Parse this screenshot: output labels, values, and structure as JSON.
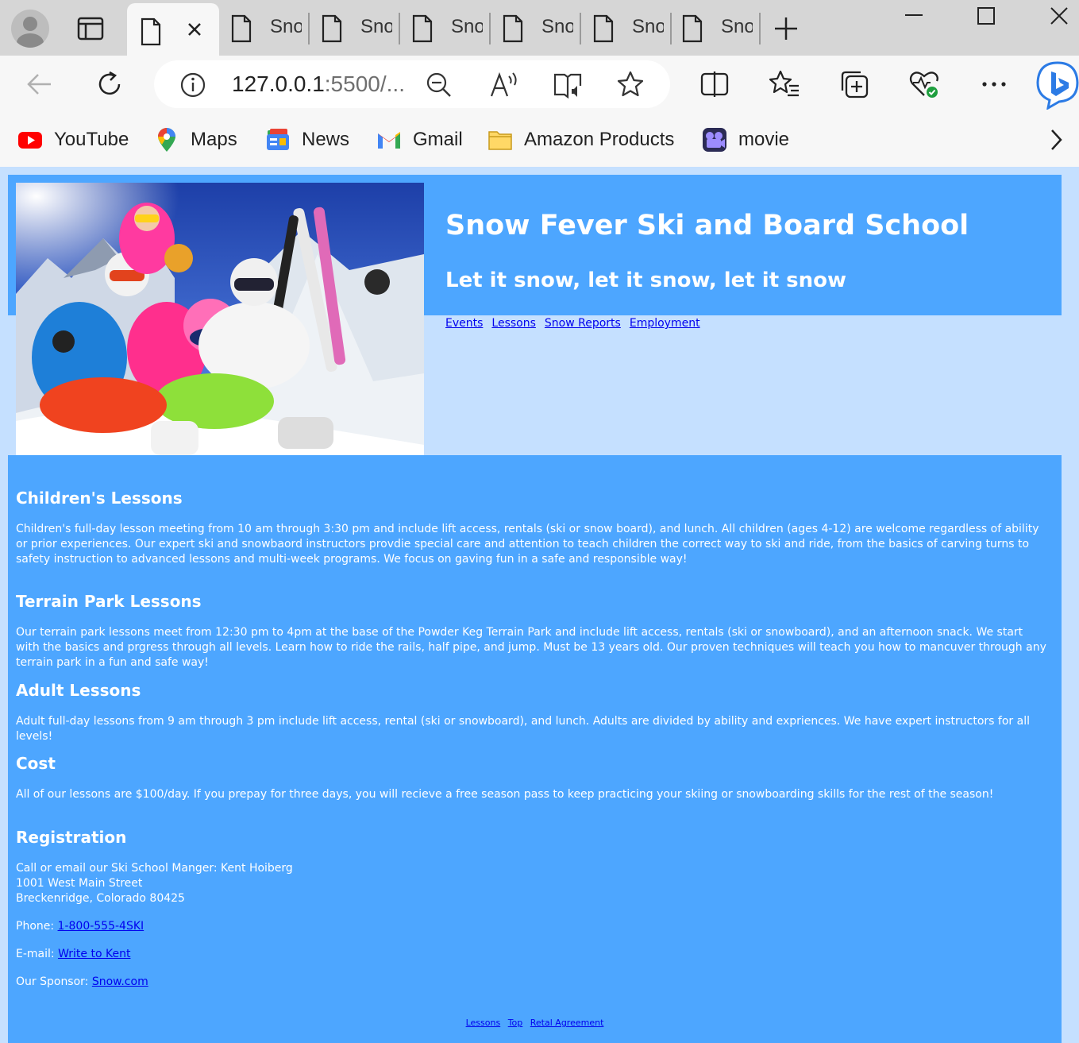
{
  "browser": {
    "tabs": [
      {
        "label": ""
      },
      {
        "label": "Snow"
      },
      {
        "label": "Snow"
      },
      {
        "label": "Snow"
      },
      {
        "label": "Snow"
      },
      {
        "label": "Snow"
      },
      {
        "label": "Snow"
      }
    ],
    "url_host": "127.0.0.1",
    "url_rest": ":5500/...",
    "bookmarks": [
      {
        "label": "YouTube",
        "icon": "youtube-icon"
      },
      {
        "label": "Maps",
        "icon": "maps-icon"
      },
      {
        "label": "News",
        "icon": "news-icon"
      },
      {
        "label": "Gmail",
        "icon": "gmail-icon"
      },
      {
        "label": "Amazon Products",
        "icon": "folder-icon"
      },
      {
        "label": "movie",
        "icon": "movie-icon"
      }
    ]
  },
  "site": {
    "title": "Snow Fever Ski and Board School",
    "tagline": "Let it snow, let it snow, let it snow",
    "nav": [
      "Events",
      "Lessons",
      "Snow Reports",
      "Employment"
    ]
  },
  "sections": {
    "children": {
      "heading": "Children's Lessons",
      "text": "Children's full-day lesson meeting from 10 am through 3:30 pm and include lift access, rentals (ski or snow board), and lunch. All children (ages 4-12) are welcome regardless of ability or prior experiences. Our expert ski and snowbaord instructors provdie special care and attention to teach children the correct way to ski and ride, from the basics of carving turns to safety instruction to advanced lessons and multi-week programs. We focus on gaving fun in a safe and responsible way!"
    },
    "terrain": {
      "heading": "Terrain Park Lessons",
      "text": "Our terrain park lessons meet from 12:30 pm to 4pm at the base of the Powder Keg Terrain Park and include lift access, rentals (ski or snowboard), and an afternoon snack. We start with the basics and prgress through all levels. Learn how to ride the rails, half pipe, and jump. Must be 13 years old. Our proven techniques will teach you how to mancuver through any terrain park in a fun and safe way!"
    },
    "adult": {
      "heading": "Adult Lessons",
      "text": "Adult full-day lessons from 9 am through 3 pm include lift access, rental (ski or snowboard), and lunch. Adults are divided by ability and expriences. We have expert instructors for all levels!"
    },
    "cost": {
      "heading": "Cost",
      "text": "All of our lessons are $100/day. If you prepay for three days, you will recieve a free season pass to keep practicing your skiing or snowboarding skills for the rest of the season!"
    },
    "registration": {
      "heading": "Registration",
      "line1": "Call or email our Ski School Manger: Kent Hoiberg",
      "line2": "1001 West Main Street",
      "line3": "Breckenridge, Colorado 80425",
      "phone_label": "Phone: ",
      "phone_link": "1-800-555-4SKI",
      "email_label": "E-mail: ",
      "email_link": "Write to Kent",
      "sponsor_label": "Our Sponsor: ",
      "sponsor_link": "Snow.com"
    }
  },
  "footer_nav": [
    "Lessons",
    "Top",
    "Retal Agreement"
  ],
  "colors": {
    "band": "#4da6ff",
    "background": "#c5e0ff",
    "link": "#0000ee"
  }
}
